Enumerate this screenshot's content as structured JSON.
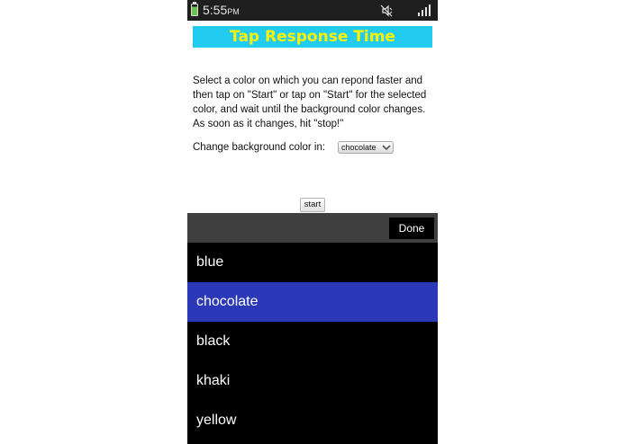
{
  "status_bar": {
    "time": "5:55",
    "ampm": "PM",
    "icons": [
      "battery-icon",
      "mute-icon",
      "signal-icon"
    ]
  },
  "page": {
    "title": "Tap Response Time",
    "instructions": "Select a color on which you can repond faster and then tap on \"Start\" or tap on \"Start\" for the selected color, and wait until the background color changes. As soon as it changes, hit \"stop!\"",
    "change_label": "Change background color in:",
    "selected_color": "chocolate",
    "start_label": "start"
  },
  "picker": {
    "done_label": "Done",
    "options": [
      "blue",
      "chocolate",
      "black",
      "khaki",
      "yellow"
    ],
    "selected_index": 1
  },
  "colors": {
    "title_bg": "#22ccf0",
    "title_text": "#fff200",
    "selected_option": "#2b39b8",
    "picker_header": "#3f3f3f"
  }
}
